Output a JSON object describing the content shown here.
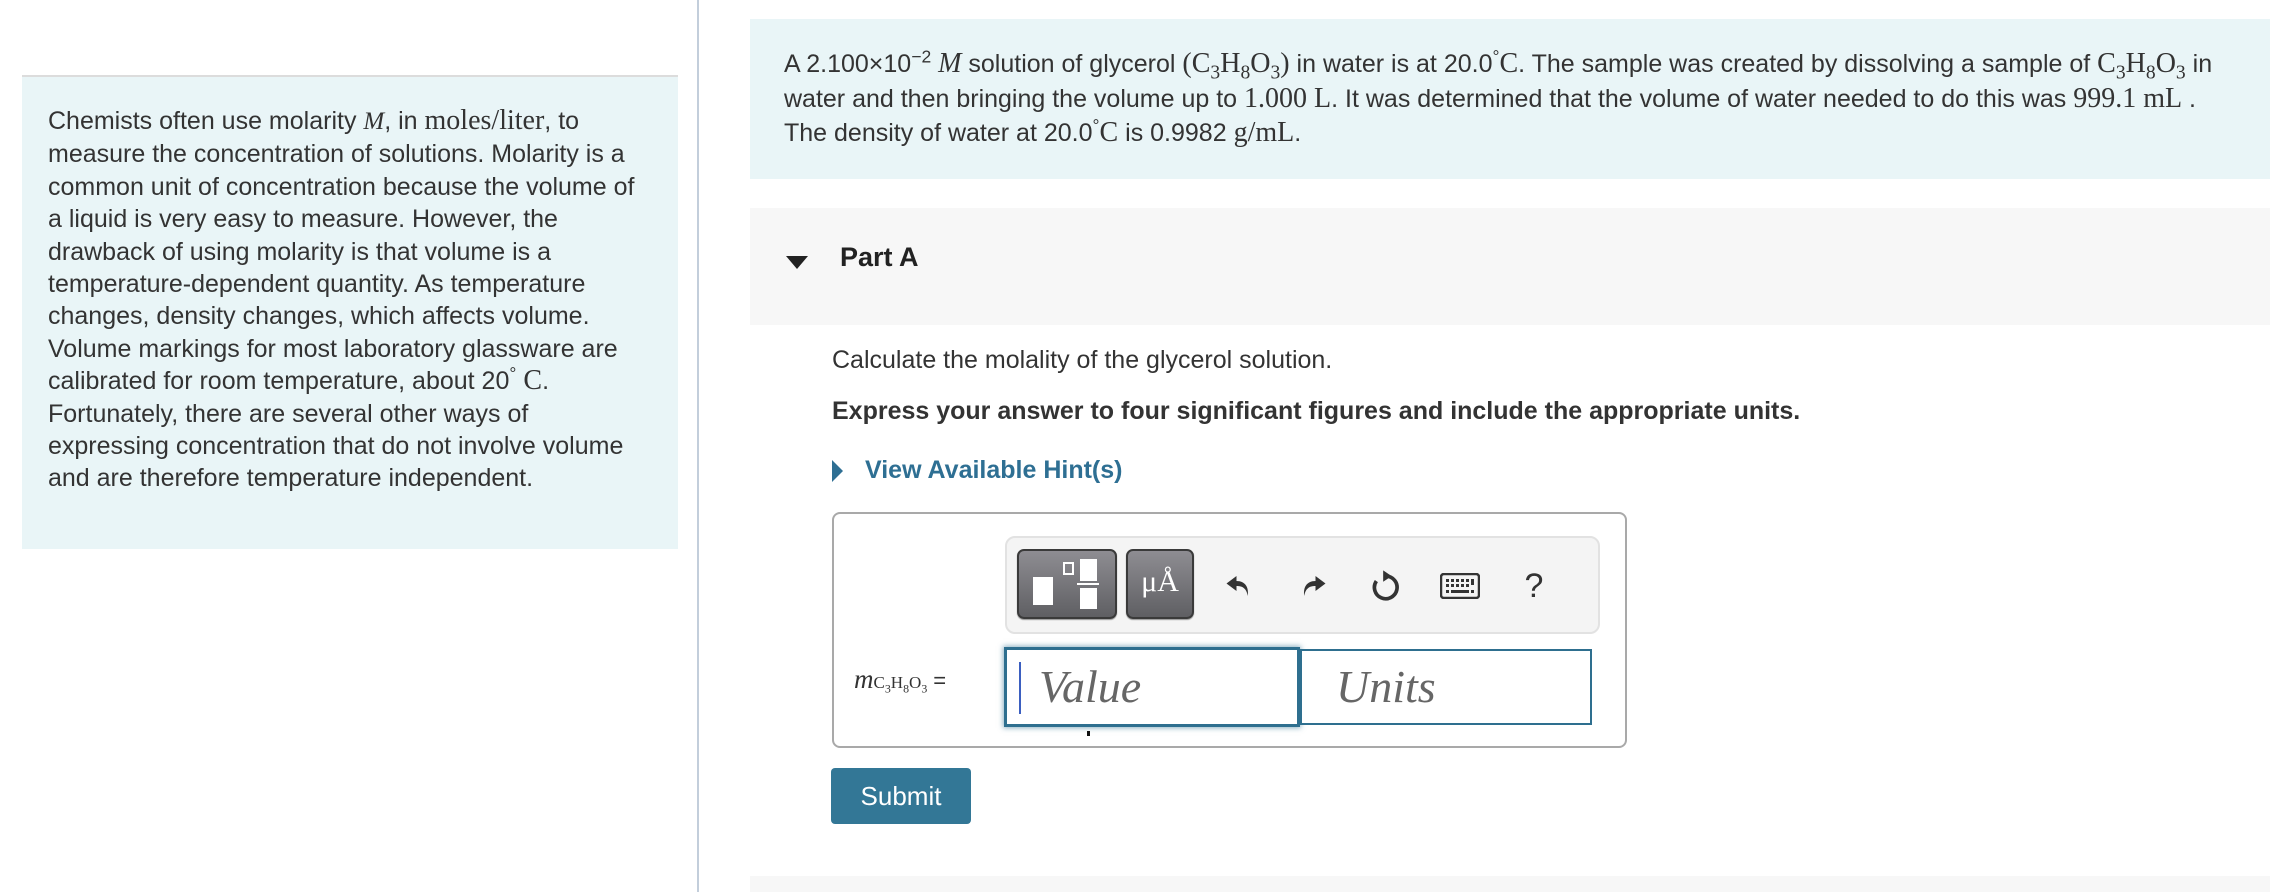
{
  "intro": {
    "segments": [
      "Chemists often use molarity ",
      "M",
      ", in ",
      "moles/liter",
      ", to measure the concentration of solutions. Molarity is a common unit of concentration because the volume of a liquid is very easy to measure. However, the drawback of using molarity is that volume is a temperature-dependent quantity. As temperature changes, density changes, which affects volume. Volume markings for most laboratory glassware are calibrated for room temperature, about 20",
      "°",
      " C",
      ". Fortunately, there are several other ways of expressing concentration that do not involve volume and are therefore temperature independent."
    ]
  },
  "problem": {
    "p1": "A 2.100×10",
    "exp": "−2",
    "molar": "M",
    "p2": " solution of glycerol ",
    "formula_open": "(C",
    "f_3": "3",
    "f_H": "H",
    "f_8": "8",
    "f_O": "O",
    "formula_close": ")",
    "p3": " in water is at 20.0",
    "deg": "°",
    "C": "C",
    "p4": ". The sample was created by dissolving a sample of ",
    "p5": " in water and then bringing the volume up to ",
    "vol": "1.000 L",
    "p6": ". It was determined that the volume of water needed to do this was ",
    "water_vol": "999.1 mL",
    "p7": " . The density of water at 20.0",
    "p8": " is 0.9982 ",
    "density_unit": "g/mL",
    "p9": "."
  },
  "part": {
    "title": "Part A",
    "question": "Calculate the molality of the glycerol solution.",
    "instruction": "Express your answer to four significant figures and include the appropriate units.",
    "hint_label": "View Available Hint(s)"
  },
  "toolbar": {
    "templates_icon": "templates-icon",
    "units_label": "μÅ",
    "undo_icon": "undo-icon",
    "redo_icon": "redo-icon",
    "reset_icon": "reset-icon",
    "keyboard_icon": "keyboard-icon",
    "help_label": "?"
  },
  "answer": {
    "variable": "m",
    "subscript_C": "C",
    "subscript_3": "3",
    "subscript_H": "H",
    "subscript_8": "8",
    "subscript_O": "O",
    "equals": "=",
    "value_placeholder": "Value",
    "units_placeholder": "Units",
    "value": "",
    "units": ""
  },
  "submit_label": "Submit",
  "colors": {
    "accent": "#337796",
    "link": "#2e6f93",
    "panel_bg": "#e9f5f7",
    "part_bg": "#f7f7f7"
  }
}
